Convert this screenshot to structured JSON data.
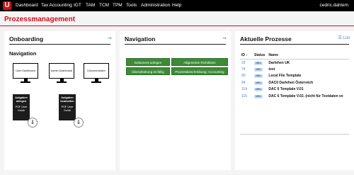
{
  "header": {
    "logo": "U",
    "nav": [
      "Dashboard",
      "Tax Accounting",
      "IGT",
      "TAM",
      "TCM",
      "TPM",
      "Tools",
      "Administration",
      "Help"
    ],
    "user": "cedric.dahlem"
  },
  "page_title": "Prozessmanagement",
  "onboarding": {
    "title": "Onboarding",
    "subtitle": "Navigation",
    "monitors": [
      "User Dashboard",
      "Admin Dashboard",
      "Dokumentation"
    ],
    "books": [
      {
        "title": "Aufgaben anlegen",
        "sub": "PDF User Guide"
      },
      {
        "title": "Aufgaben bearbeiten",
        "sub": "PDF User Guide"
      }
    ]
  },
  "navigation": {
    "title": "Navigation",
    "buttons": [
      "Dokument anlegen",
      "Allgemeine Richtlinien",
      "Überarbeitung ist fällig",
      "Prozessbeschreibung: Accounting"
    ]
  },
  "prozesse": {
    "title": "Aktuelle Prozesse",
    "list_label": "List",
    "columns": [
      "ID",
      "Status",
      "Name"
    ],
    "rows": [
      {
        "id": "29",
        "status": "NEU",
        "name": "Darlehen UK"
      },
      {
        "id": "74",
        "status": "NEU",
        "name": "test"
      },
      {
        "id": "90",
        "status": "NEU",
        "name": "Local File Template"
      },
      {
        "id": "94",
        "status": "NEU",
        "name": "DAC6 Darlehen Österreich"
      },
      {
        "id": "114",
        "status": "NEU",
        "name": "DAC 6 Template V.01"
      },
      {
        "id": "115",
        "status": "NEU",
        "name": "DAC 6 Template V.02. (nicht für Testdaten ve"
      }
    ]
  }
}
